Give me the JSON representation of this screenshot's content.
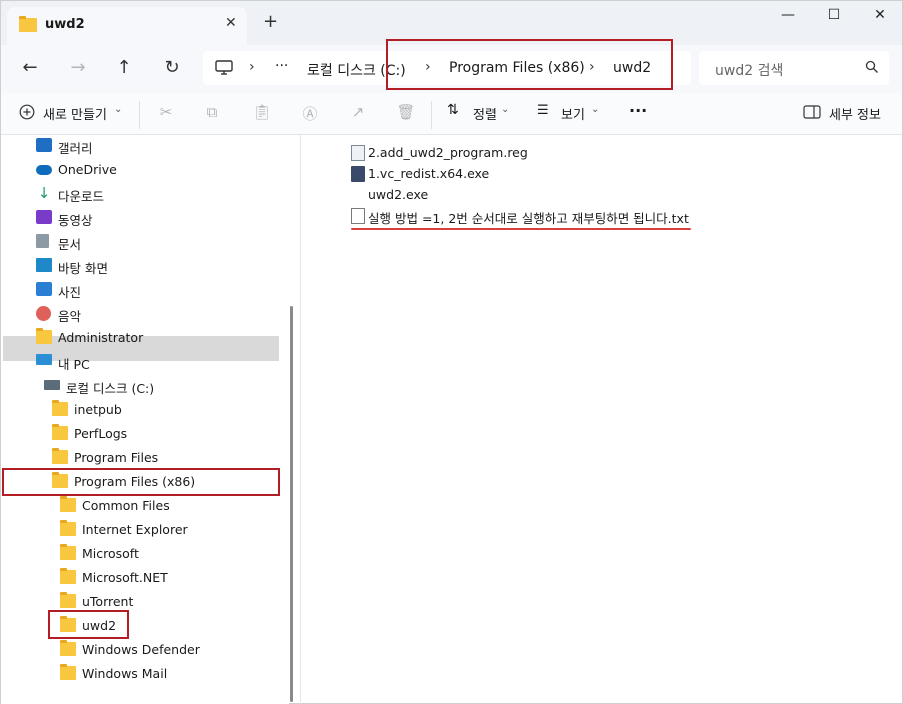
{
  "titlebar": {
    "tab_title": "uwd2",
    "close": "✕",
    "new_tab": "+",
    "minimize": "—",
    "maximize": "☐",
    "close_window": "✕"
  },
  "nav": {
    "back": "←",
    "forward": "→",
    "up": "↑",
    "refresh": "↻",
    "breadcrumb": [
      "로컬 디스크 (C:)",
      "Program Files (x86)",
      "uwd2"
    ],
    "ellipsis": "···",
    "search_placeholder": "uwd2 검색"
  },
  "toolbar": {
    "new_label": "새로 만들기",
    "sort_label": "정렬",
    "view_label": "보기",
    "more": "···",
    "details_label": "세부 정보"
  },
  "sidebar": {
    "quick": [
      "갤러리",
      "OneDrive",
      "다운로드",
      "동영상",
      "문서",
      "바탕 화면",
      "사진",
      "음악",
      "Administrator",
      "내 PC"
    ],
    "drive": "로컬 디스크 (C:)",
    "c_folders": [
      "inetpub",
      "PerfLogs",
      "Program Files",
      "Program Files (x86)"
    ],
    "x86_folders": [
      "Common Files",
      "Internet Explorer",
      "Microsoft",
      "Microsoft.NET",
      "uTorrent",
      "uwd2",
      "Windows Defender",
      "Windows Mail"
    ]
  },
  "files": [
    {
      "name": "2.add_uwd2_program.reg",
      "icon": "registry-icon"
    },
    {
      "name": "1.vc_redist.x64.exe",
      "icon": "installer-icon"
    },
    {
      "name": "uwd2.exe",
      "icon": "exe-icon"
    },
    {
      "name": "실행 방법 =1, 2번 순서대로 실행하고 재부팅하면 됩니다.txt",
      "icon": "text-file-icon"
    }
  ],
  "colors": {
    "highlight": "#b21e23",
    "underline": "#d8403a",
    "folder": "#f8c63f"
  }
}
